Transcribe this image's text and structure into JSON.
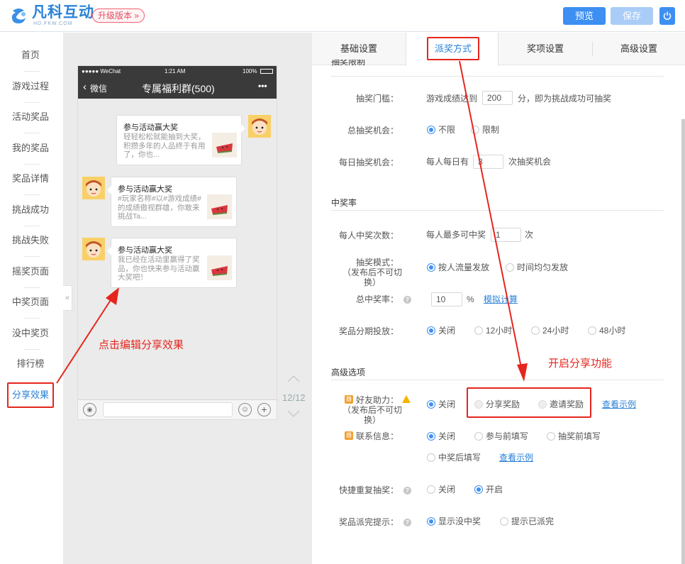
{
  "header": {
    "brand_cn": "凡科互动",
    "brand_en": "HD.FKW.COM",
    "upgrade": "升级版本 »",
    "preview": "预览",
    "save": "保存",
    "accent": "#3d8ff1"
  },
  "sidebar": {
    "items": [
      "首页",
      "游戏过程",
      "活动奖品",
      "我的奖品",
      "奖品详情",
      "挑战成功",
      "挑战失败",
      "摇奖页面",
      "中奖页面",
      "没中奖页",
      "排行榜",
      "分享效果"
    ],
    "active": "分享效果"
  },
  "phone": {
    "status_left": "●●●●● WeChat",
    "status_time": "1:21 AM",
    "status_battery": "100%",
    "back": "微信",
    "chat_title": "专属福利群(500)",
    "more": "•••",
    "messages": [
      {
        "title": "参与活动赢大奖",
        "desc": "轻轻松松就能抽到大奖，积攒多年的人品终于有用了，你也..."
      },
      {
        "title": "参与活动赢大奖",
        "desc": "#玩家名称#以#游戏成绩#的成绩傲视群雄，你敢来挑战Ta..."
      },
      {
        "title": "参与活动赢大奖",
        "desc": "我已经在活动里赢得了奖品，你也快来参与活动赢大奖吧！"
      }
    ],
    "collapse": "«",
    "page": "12/12"
  },
  "tabs": [
    "基础设置",
    "派奖方式",
    "奖项设置",
    "高级设置"
  ],
  "form": {
    "sec_limit": "抽奖限制",
    "threshold_label": "抽奖门槛：",
    "threshold_pre": "游戏成绩达到",
    "threshold_val": "200",
    "threshold_post": "分，即为挑战成功可抽奖",
    "total_label": "总抽奖机会：",
    "total_opt1": "不限",
    "total_opt2": "限制",
    "daily_label": "每日抽奖机会：",
    "daily_pre": "每人每日有",
    "daily_val": "3",
    "daily_post": "次抽奖机会",
    "sec_rate": "中奖率",
    "per_label": "每人中奖次数：",
    "per_pre": "每人最多可中奖",
    "per_val": "1",
    "per_post": "次",
    "mode_label": "抽奖模式：",
    "mode_sub": "（发布后不可切换）",
    "mode_opt1": "按人流量发放",
    "mode_opt2": "时间均匀发放",
    "rate_label": "总中奖率：",
    "rate_val": "10",
    "rate_unit": "%",
    "rate_link": "模拟计算",
    "stage_label": "奖品分期投放：",
    "stage_opts": [
      "关闭",
      "12小时",
      "24小时",
      "48小时"
    ],
    "sec_adv": "高级选项",
    "friend_label": "好友助力：",
    "friend_sub": "（发布后不可切换）",
    "friend_opt1": "关闭",
    "friend_opt2": "分享奖励",
    "friend_opt3": "邀请奖励",
    "friend_link": "查看示例",
    "contact_label": "联系信息：",
    "contact_opts": [
      "关闭",
      "参与前填写",
      "抽奖前填写",
      "中奖后填写"
    ],
    "contact_link": "查看示例",
    "quick_label": "快捷重复抽奖：",
    "quick_opt1": "关闭",
    "quick_opt2": "开启",
    "tip_label": "奖品派完提示：",
    "tip_opt1": "显示没中奖",
    "tip_opt2": "提示已派完",
    "badge": "器"
  },
  "annotations": {
    "left": "点击编辑分享效果",
    "right": "开启分享功能",
    "color": "#e5261d"
  }
}
